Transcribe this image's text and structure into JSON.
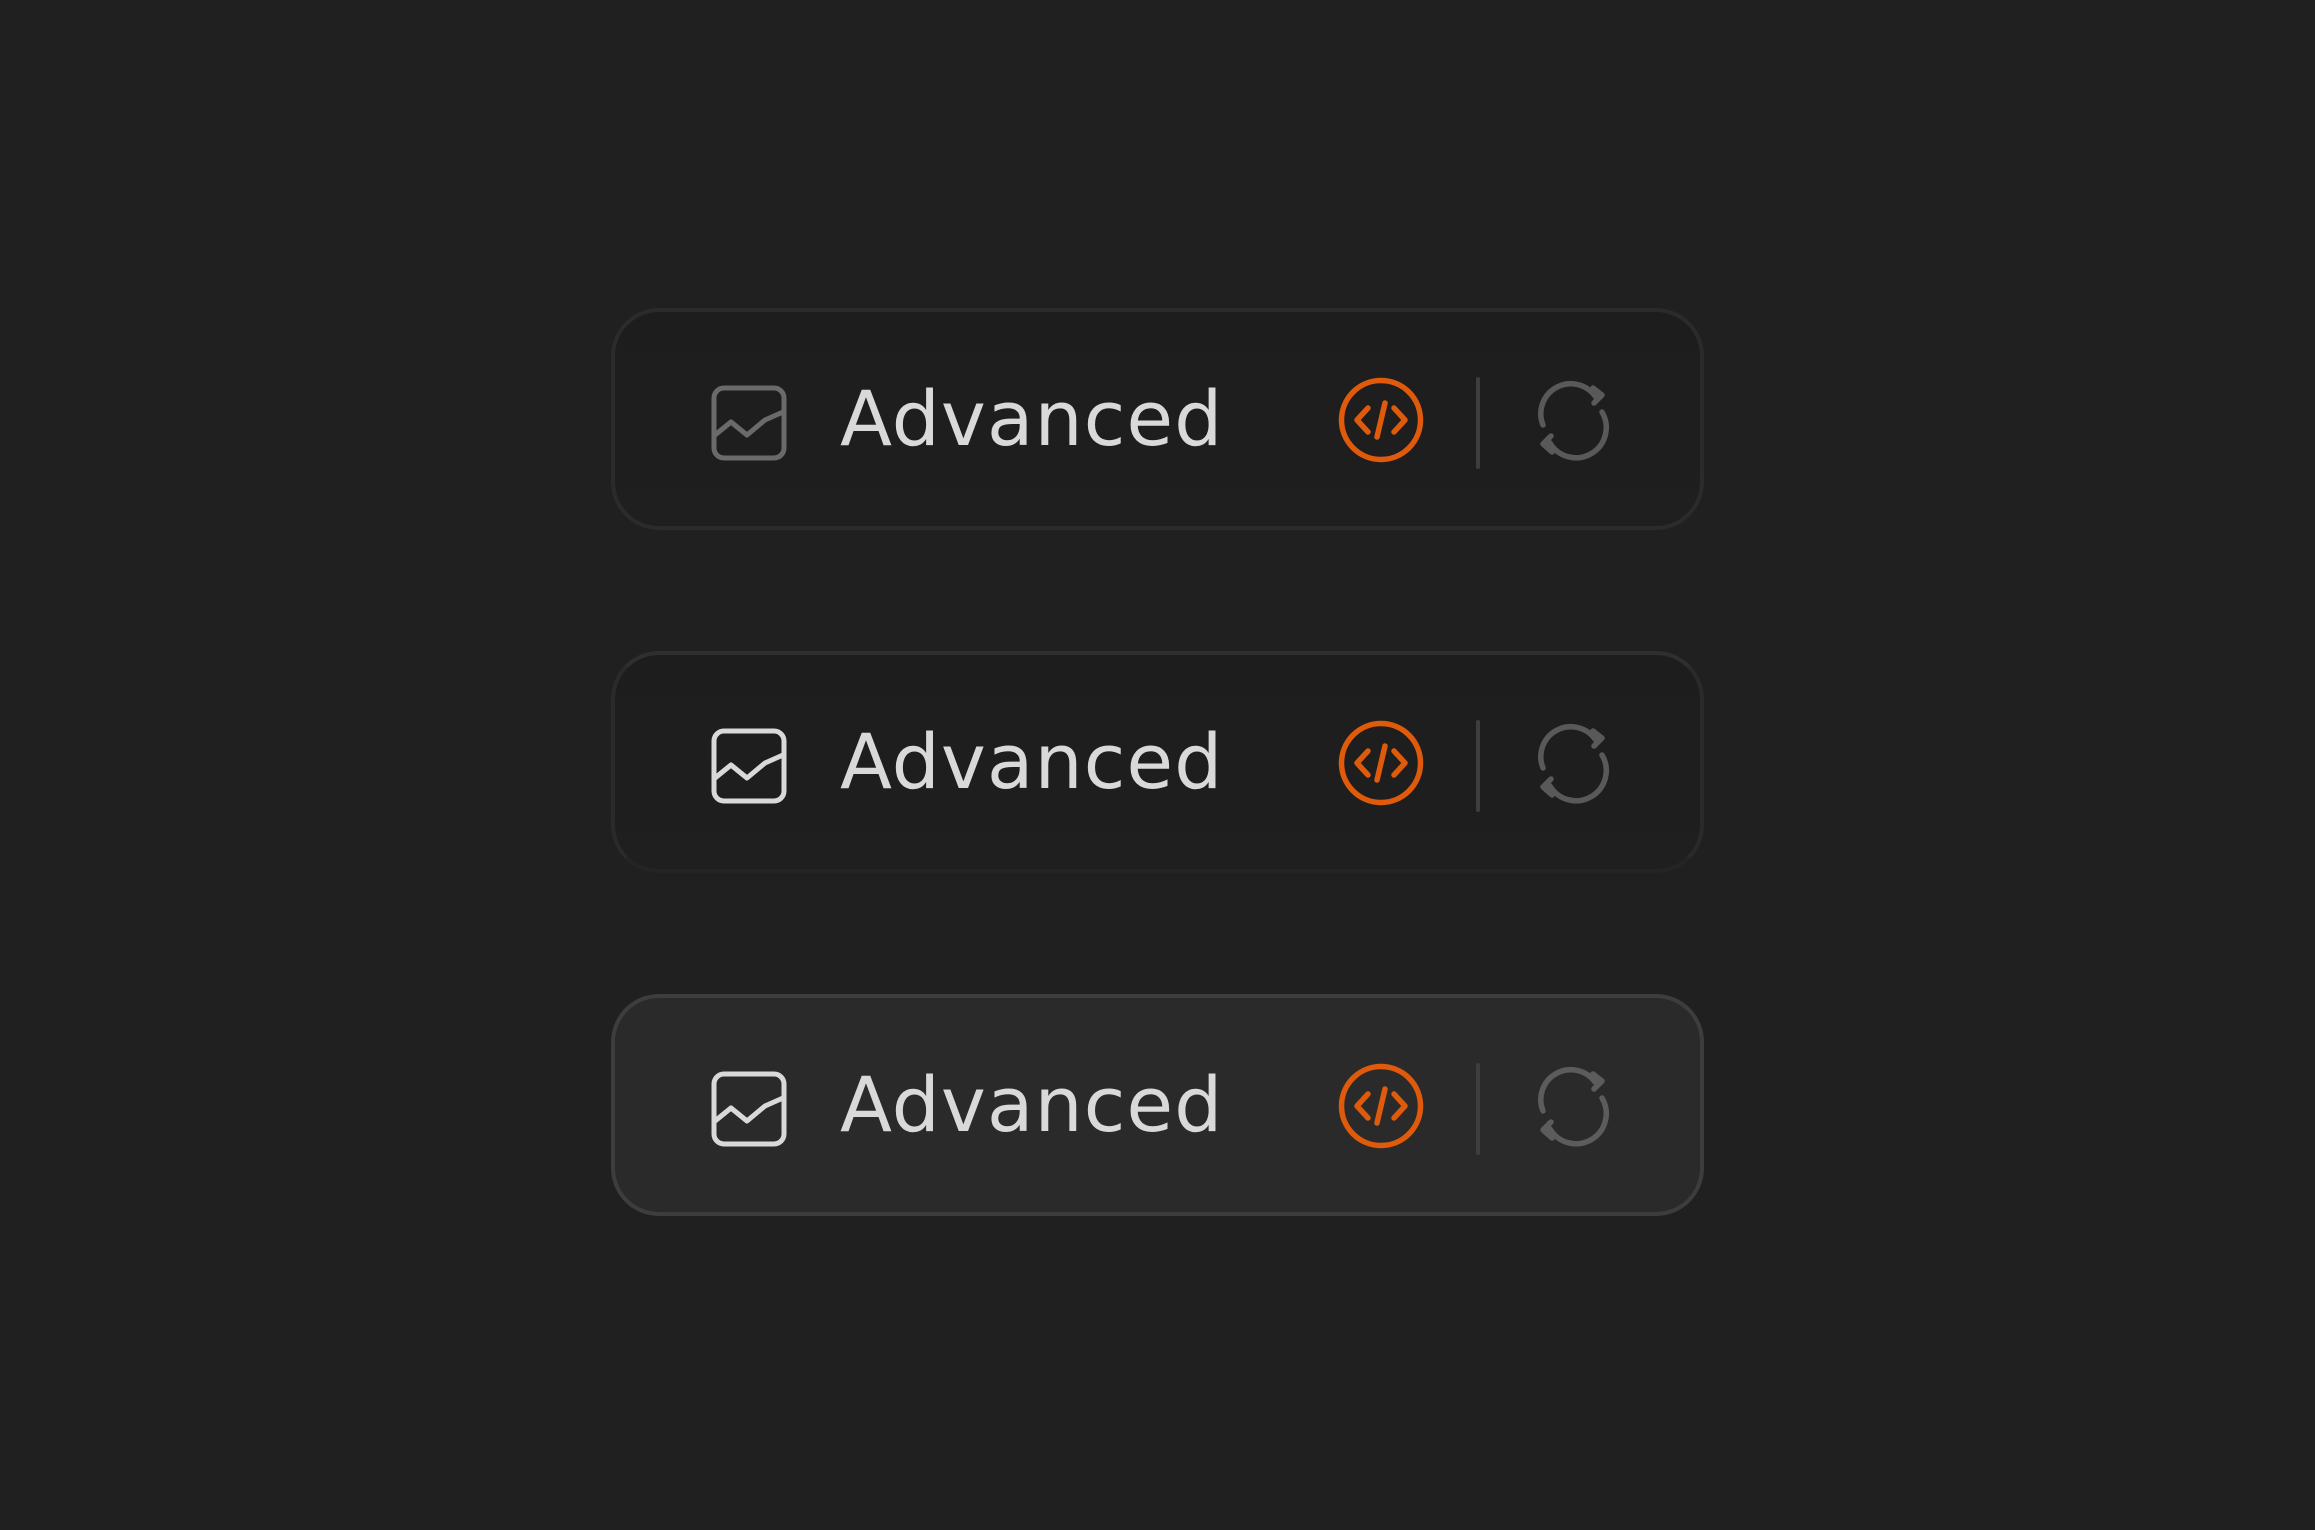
{
  "colors": {
    "background": "#202020",
    "accent": "#e05a0c",
    "label": "#d9d9d9",
    "icon_muted": "#6a6a6a",
    "icon_bright": "#d9d9d9",
    "refresh_icon": "#5a5a5a"
  },
  "chips": [
    {
      "state": "default",
      "label": "Advanced",
      "leading_icon": "graph-chart-icon",
      "trailing_icons": [
        "code-icon",
        "refresh-icon"
      ]
    },
    {
      "state": "hover",
      "label": "Advanced",
      "leading_icon": "graph-chart-icon",
      "trailing_icons": [
        "code-icon",
        "refresh-icon"
      ]
    },
    {
      "state": "active",
      "label": "Advanced",
      "leading_icon": "graph-chart-icon",
      "trailing_icons": [
        "code-icon",
        "refresh-icon"
      ]
    }
  ]
}
